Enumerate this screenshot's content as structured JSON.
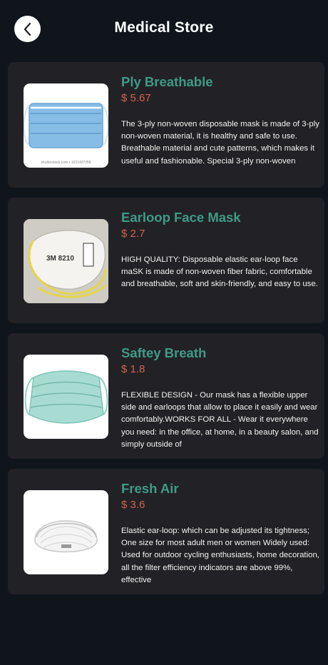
{
  "header": {
    "title": "Medical Store",
    "back_icon": "chevron-left-icon"
  },
  "products": [
    {
      "name": "Ply Breathable",
      "price": "$ 5.67",
      "description": "The 3-ply non-woven disposable mask is made of 3-ply non-woven material, it is healthy and safe to use. Breathable material and cute patterns, which makes it useful and fashionable. Special 3-ply non-woven",
      "image": "surgical-mask-image",
      "image_caption": "shutterstock.com • 1631407358"
    },
    {
      "name": "Earloop Face Mask",
      "price": "$ 2.7",
      "description": "HIGH QUALITY: Disposable elastic ear-loop face maSK is made of non-woven fiber fabric, comfortable and breathable, soft and skin-friendly, and easy to use.",
      "image": "n95-respirator-image",
      "image_caption": "3M 8210"
    },
    {
      "name": "Saftey Breath",
      "price": "$ 1.8",
      "description": "FLEXIBLE DESIGN - Our mask has a flexible upper side and earloops that allow to place it easily and wear comfortably.WORKS FOR ALL - Wear it everywhere you need: in the office, at home, in a beauty salon, and simply outside of",
      "image": "green-pleated-mask-image"
    },
    {
      "name": "Fresh Air",
      "price": "$ 3.6",
      "description": "Elastic ear-loop: which can be adjusted its tightness; One size for most adult men or women Widely used: Used for outdoor cycling enthusiasts, home decoration, all the filter efficiency indicators are above 99%, effective",
      "image": "white-cup-respirator-image"
    }
  ],
  "colors": {
    "background": "#0f151b",
    "card": "#222226",
    "name": "#3f9a87",
    "price": "#d2604c"
  }
}
